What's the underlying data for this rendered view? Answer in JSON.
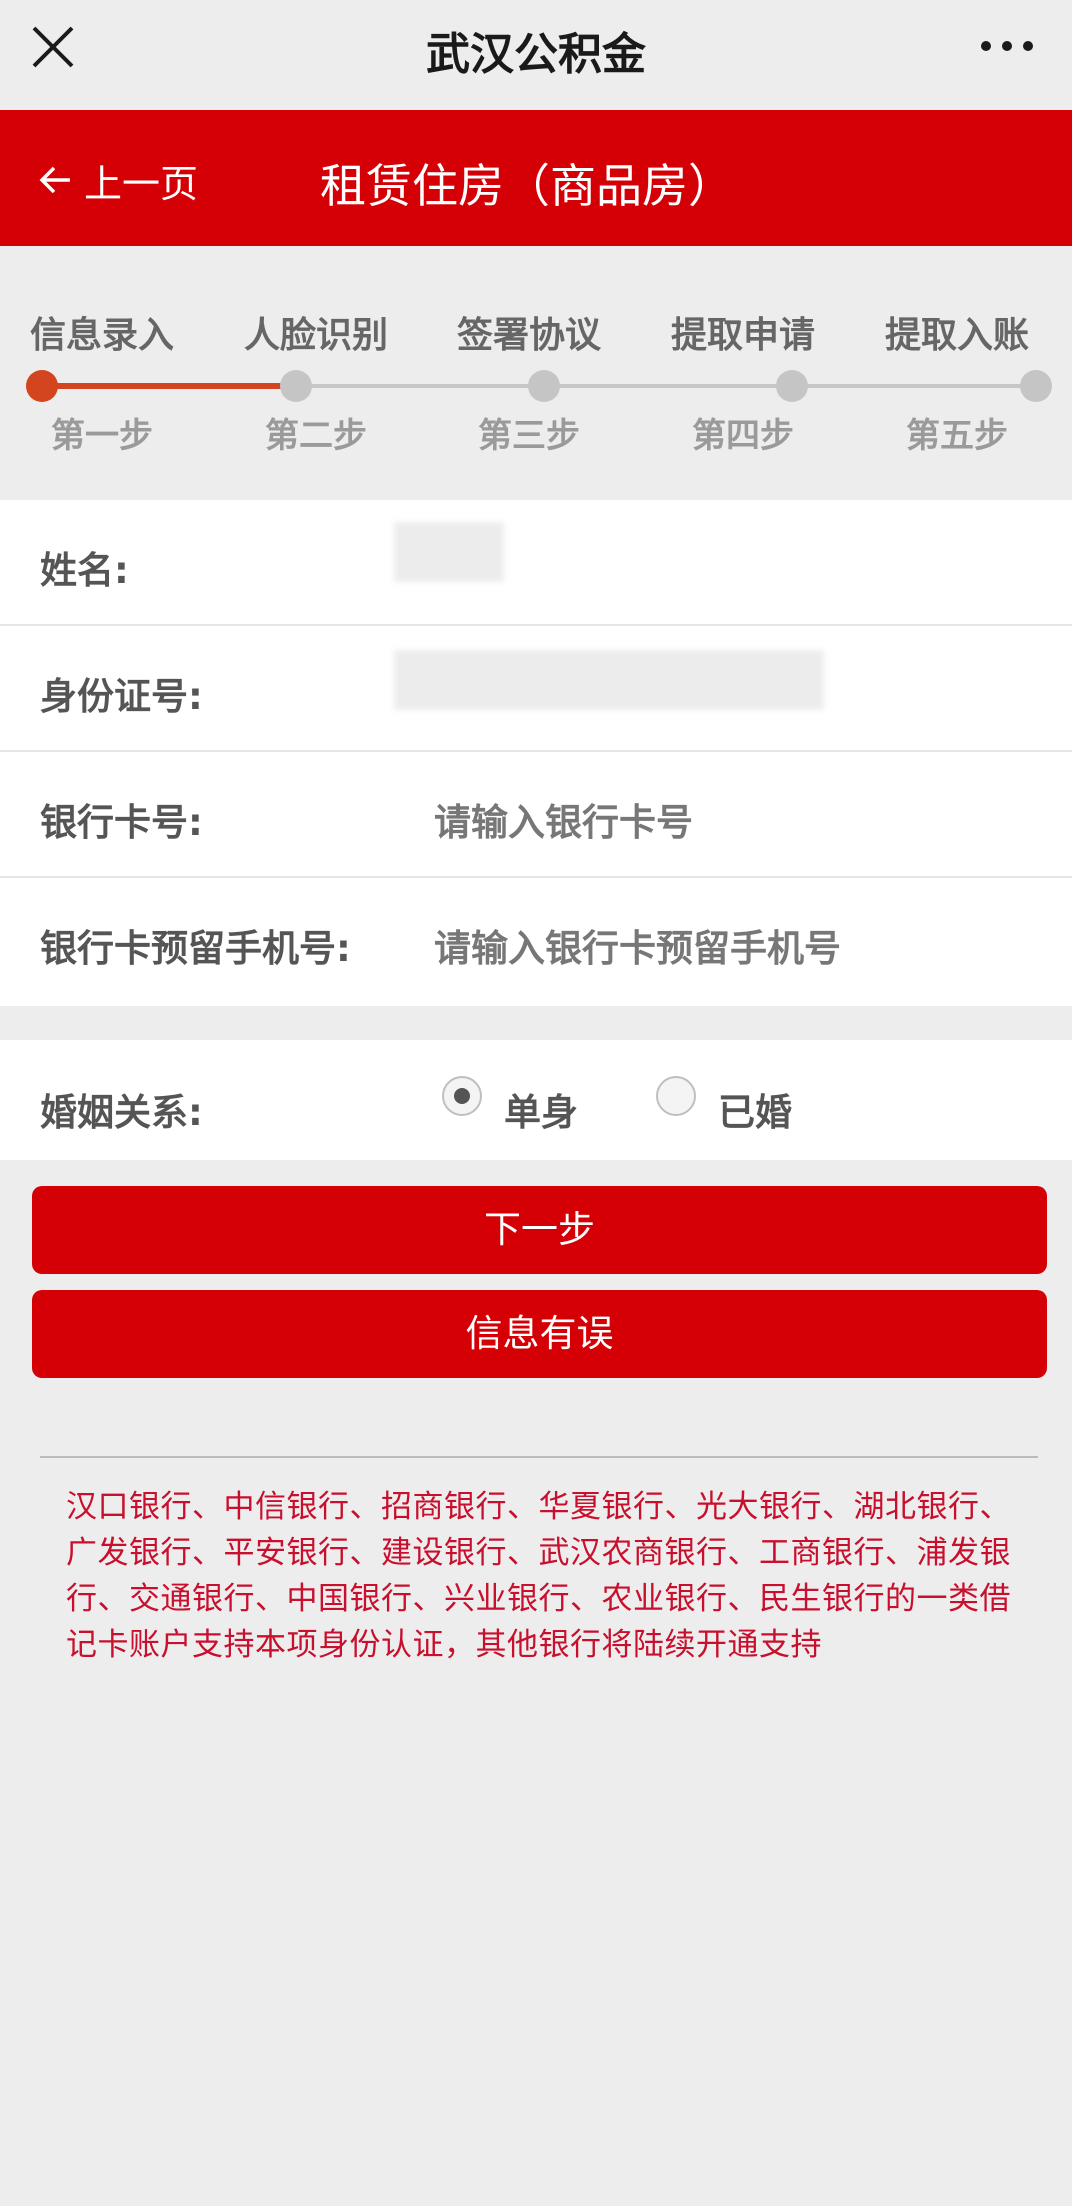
{
  "topbar": {
    "title": "武汉公积金"
  },
  "header": {
    "back_label": "上一页",
    "page_title": "租赁住房（商品房）"
  },
  "steps": [
    {
      "label": "信息录入",
      "sub": "第一步"
    },
    {
      "label": "人脸识别",
      "sub": "第二步"
    },
    {
      "label": "签署协议",
      "sub": "第三步"
    },
    {
      "label": "提取申请",
      "sub": "第四步"
    },
    {
      "label": "提取入账",
      "sub": "第五步"
    }
  ],
  "current_step": 1,
  "form": {
    "name_label": "姓名:",
    "id_label": "身份证号:",
    "card_label": "银行卡号:",
    "card_placeholder": "请输入银行卡号",
    "phone_label": "银行卡预留手机号:",
    "phone_placeholder": "请输入银行卡预留手机号"
  },
  "marriage": {
    "label": "婚姻关系:",
    "options": [
      "单身",
      "已婚"
    ],
    "selected": "单身"
  },
  "buttons": {
    "next": "下一步",
    "error": "信息有误"
  },
  "notice": "汉口银行、中信银行、招商银行、华夏银行、光大银行、湖北银行、广发银行、平安银行、建设银行、武汉农商银行、工商银行、浦发银行、交通银行、中国银行、兴业银行、农业银行、民生银行的一类借记卡账户支持本项身份认证，其他银行将陆续开通支持",
  "colors": {
    "brand_red": "#d50005",
    "progress": "#d2451e",
    "notice_red": "#c8102e"
  }
}
